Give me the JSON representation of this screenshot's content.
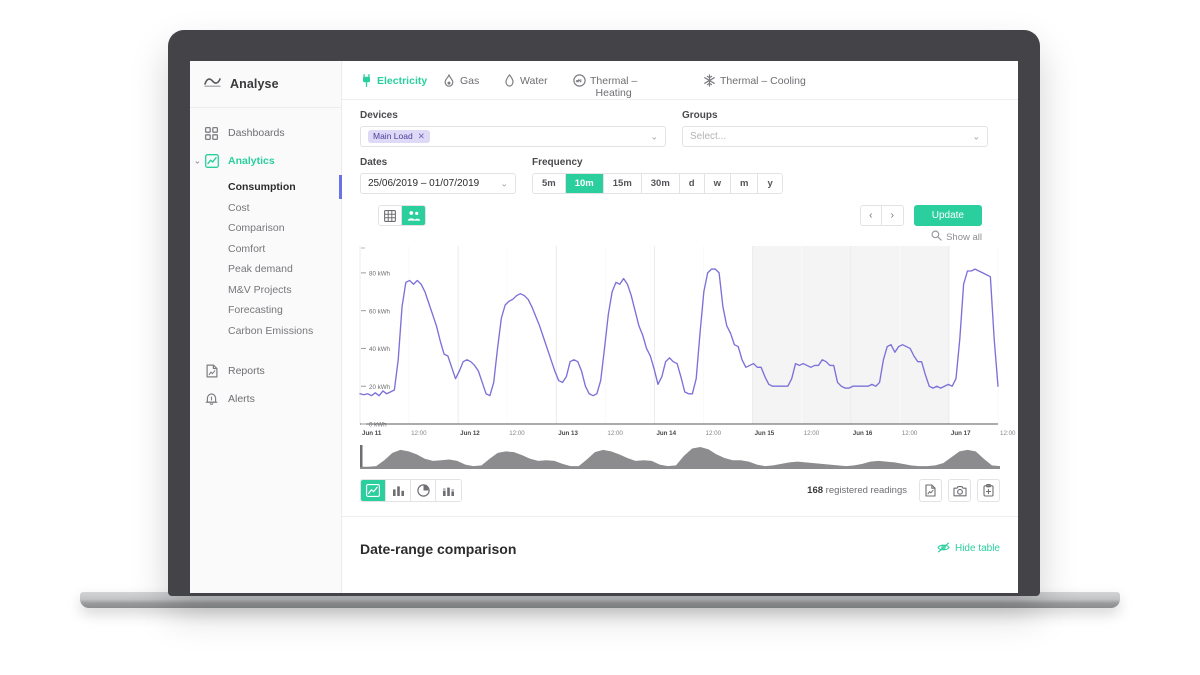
{
  "brand": {
    "name": "Analyse",
    "logo_icon": "wave-logo-icon"
  },
  "sidebar": {
    "items": [
      {
        "label": "Dashboards",
        "icon": "grid-squares-icon",
        "active": false
      },
      {
        "label": "Analytics",
        "icon": "line-chart-square-icon",
        "active": true
      },
      {
        "label": "Reports",
        "icon": "document-icon",
        "active": false
      },
      {
        "label": "Alerts",
        "icon": "bell-icon",
        "active": false
      }
    ],
    "analytics_subitems": [
      {
        "label": "Consumption",
        "current": true
      },
      {
        "label": "Cost",
        "current": false
      },
      {
        "label": "Comparison",
        "current": false
      },
      {
        "label": "Comfort",
        "current": false
      },
      {
        "label": "Peak demand",
        "current": false
      },
      {
        "label": "M&V Projects",
        "current": false
      },
      {
        "label": "Forecasting",
        "current": false
      },
      {
        "label": "Carbon Emissions",
        "current": false
      }
    ]
  },
  "tabs": [
    {
      "label": "Electricity",
      "icon": "plug-icon",
      "active": true
    },
    {
      "label": "Gas",
      "icon": "flame-icon",
      "active": false
    },
    {
      "label": "Water",
      "icon": "droplet-icon",
      "active": false
    },
    {
      "label": "Thermal –",
      "label2": "Heating",
      "icon": "thermal-meter-icon",
      "active": false
    },
    {
      "label": "Thermal – Cooling",
      "icon": "snowflake-icon",
      "active": false
    }
  ],
  "filters": {
    "devices_label": "Devices",
    "devices_chip": "Main Load",
    "devices_chip_remove": "✕",
    "groups_label": "Groups",
    "groups_placeholder": "Select...",
    "dates_label": "Dates",
    "dates_value": "25/06/2019 – 01/07/2019",
    "frequency_label": "Frequency",
    "frequency_options": [
      "5m",
      "10m",
      "15m",
      "30m",
      "d",
      "w",
      "m",
      "y"
    ],
    "frequency_selected": "10m"
  },
  "toolbar": {
    "view_table_icon": "table-grid-icon",
    "view_group_icon": "people-group-icon",
    "view_selected": "people-group-icon",
    "prev_label": "‹",
    "next_label": "›",
    "update_label": "Update",
    "show_all_label": "Show all",
    "show_all_icon": "magnifier-icon"
  },
  "bottom_toolbar": {
    "chart_types": [
      {
        "icon": "line-chart-icon",
        "selected": true
      },
      {
        "icon": "bar-chart-icon",
        "selected": false
      },
      {
        "icon": "pie-chart-icon",
        "selected": false
      },
      {
        "icon": "stacked-bar-icon",
        "selected": false
      }
    ],
    "readings_count": "168",
    "readings_label": "registered readings",
    "actions": [
      {
        "icon": "export-document-icon"
      },
      {
        "icon": "camera-snapshot-icon"
      },
      {
        "icon": "clipboard-add-icon"
      }
    ]
  },
  "section": {
    "title": "Date-range comparison",
    "hide_table_label": "Hide table",
    "hide_table_icon": "eye-off-icon"
  },
  "colors": {
    "accent": "#2bcf9e",
    "series_line": "#7b71d8",
    "chip_bg": "#ded9f6",
    "chip_text": "#4a3f97",
    "weekend_band": "#f4f4f5",
    "navigator_fill": "#8c8c8e",
    "bezel": "#434348"
  },
  "chart_data": {
    "type": "line",
    "title": "",
    "xlabel": "",
    "ylabel": "kWh",
    "ylim": [
      0,
      90
    ],
    "y_ticks": [
      0,
      20,
      40,
      60,
      80
    ],
    "y_tick_labels": [
      "0 kWh",
      "20 kWh",
      "40 kWh",
      "60 kWh",
      "80 kWh"
    ],
    "x_tick_labels": [
      "Jun 11",
      "12:00",
      "Jun 12",
      "12:00",
      "Jun 13",
      "12:00",
      "Jun 14",
      "12:00",
      "Jun 15",
      "12:00",
      "Jun 16",
      "12:00",
      "Jun 17",
      "12:00"
    ],
    "grid": true,
    "legend": false,
    "shaded_bands": [
      {
        "from_label": "Jun 15",
        "to_label": "Jun 17",
        "note": "weekend"
      }
    ],
    "series": [
      {
        "name": "Main Load",
        "color": "#7b71d8",
        "unit": "kWh",
        "values": [
          16,
          15.5,
          16,
          15,
          16.5,
          15,
          17.5,
          16,
          17,
          18,
          34,
          62,
          75,
          76,
          74,
          76,
          74,
          70,
          64,
          58,
          52,
          44,
          37,
          36,
          30,
          24,
          28,
          33,
          34,
          33,
          31,
          28,
          22,
          16,
          15,
          22,
          40,
          56,
          63,
          65,
          66,
          68,
          69,
          68,
          66,
          62,
          57,
          52,
          46,
          40,
          34,
          28,
          23,
          22,
          25,
          33,
          34,
          33,
          28,
          20,
          16,
          15,
          16,
          23,
          40,
          58,
          70,
          75,
          74,
          77,
          74,
          68,
          60,
          52,
          47,
          40,
          36,
          29,
          21,
          25,
          33,
          35,
          33,
          32,
          25,
          17,
          16,
          16,
          24,
          48,
          70,
          80,
          82,
          82,
          80,
          62,
          52,
          48,
          42,
          41,
          34,
          30,
          31,
          32,
          30,
          30,
          25,
          21,
          20,
          20,
          20,
          20,
          20,
          24,
          32,
          31,
          32,
          31,
          30,
          31,
          31,
          34,
          33,
          31,
          31,
          22,
          20,
          19,
          19,
          20,
          20,
          20,
          20,
          20,
          21,
          20,
          22,
          34,
          41,
          42,
          38,
          41,
          42,
          41,
          40,
          36,
          33,
          33,
          26,
          20,
          19,
          20,
          19,
          20,
          21,
          20,
          24,
          45,
          74,
          81,
          81,
          82,
          81,
          80,
          79,
          78,
          45,
          20
        ]
      }
    ],
    "navigator_series": {
      "name": "Main Load overview",
      "color": "#8c8c8e",
      "values": [
        3,
        3,
        4,
        12,
        22,
        26,
        24,
        20,
        14,
        11,
        12,
        13,
        11,
        6,
        4,
        5,
        14,
        22,
        24,
        23,
        19,
        14,
        11,
        12,
        11,
        7,
        4,
        4,
        13,
        23,
        26,
        24,
        20,
        15,
        11,
        12,
        11,
        6,
        4,
        5,
        18,
        28,
        30,
        27,
        20,
        15,
        12,
        12,
        10,
        6,
        4,
        5,
        7,
        9,
        10,
        9,
        8,
        7,
        6,
        5,
        4,
        5,
        7,
        10,
        11,
        10,
        9,
        7,
        5,
        4,
        4,
        5,
        8,
        16,
        24,
        26,
        24,
        14,
        5,
        4
      ]
    }
  }
}
